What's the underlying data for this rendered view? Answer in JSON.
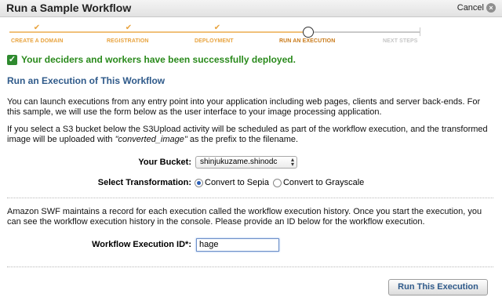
{
  "header": {
    "title": "Run a Sample Workflow",
    "cancel_label": "Cancel",
    "cancel_icon": "close-circle-icon"
  },
  "steps": [
    {
      "label": "CREATE A DOMAIN",
      "state": "done"
    },
    {
      "label": "REGISTRATION",
      "state": "done"
    },
    {
      "label": "DEPLOYMENT",
      "state": "done"
    },
    {
      "label": "RUN AN EXECUTION",
      "state": "active"
    },
    {
      "label": "NEXT STEPS",
      "state": "todo"
    }
  ],
  "success_message": "Your deciders and workers have been successfully deployed.",
  "section_heading": "Run an Execution of This Workflow",
  "intro_paragraph": "You can launch executions from any entry point into your application including web pages, clients and server back-ends. For this sample, we will use the form below as the user interface to your image processing application.",
  "bucket_paragraph": {
    "before": "If you select a S3 bucket below the S3Upload activity will be scheduled as part of the workflow execution, and the transformed image will be uploaded with ",
    "emphasis": "\"converted_image\"",
    "after": " as the prefix to the filename."
  },
  "form": {
    "bucket_label": "Your Bucket:",
    "bucket_selected": "shinjukuzame.shinodc",
    "transformation_label": "Select Transformation:",
    "transformation_options": [
      {
        "label": "Convert to Sepia",
        "checked": true
      },
      {
        "label": "Convert to Grayscale",
        "checked": false
      }
    ]
  },
  "history_paragraph": "Amazon SWF maintains a record for each execution called the workflow execution history. Once you start the execution, you can see the workflow execution history in the console. Please provide an ID below for the workflow execution.",
  "execution_id": {
    "label": "Workflow Execution ID*:",
    "value": "hage"
  },
  "run_button_label": "Run This Execution",
  "colors": {
    "accent_orange": "#e8a33e",
    "success_green": "#2a8a1c",
    "heading_blue": "#2f5a8a"
  }
}
